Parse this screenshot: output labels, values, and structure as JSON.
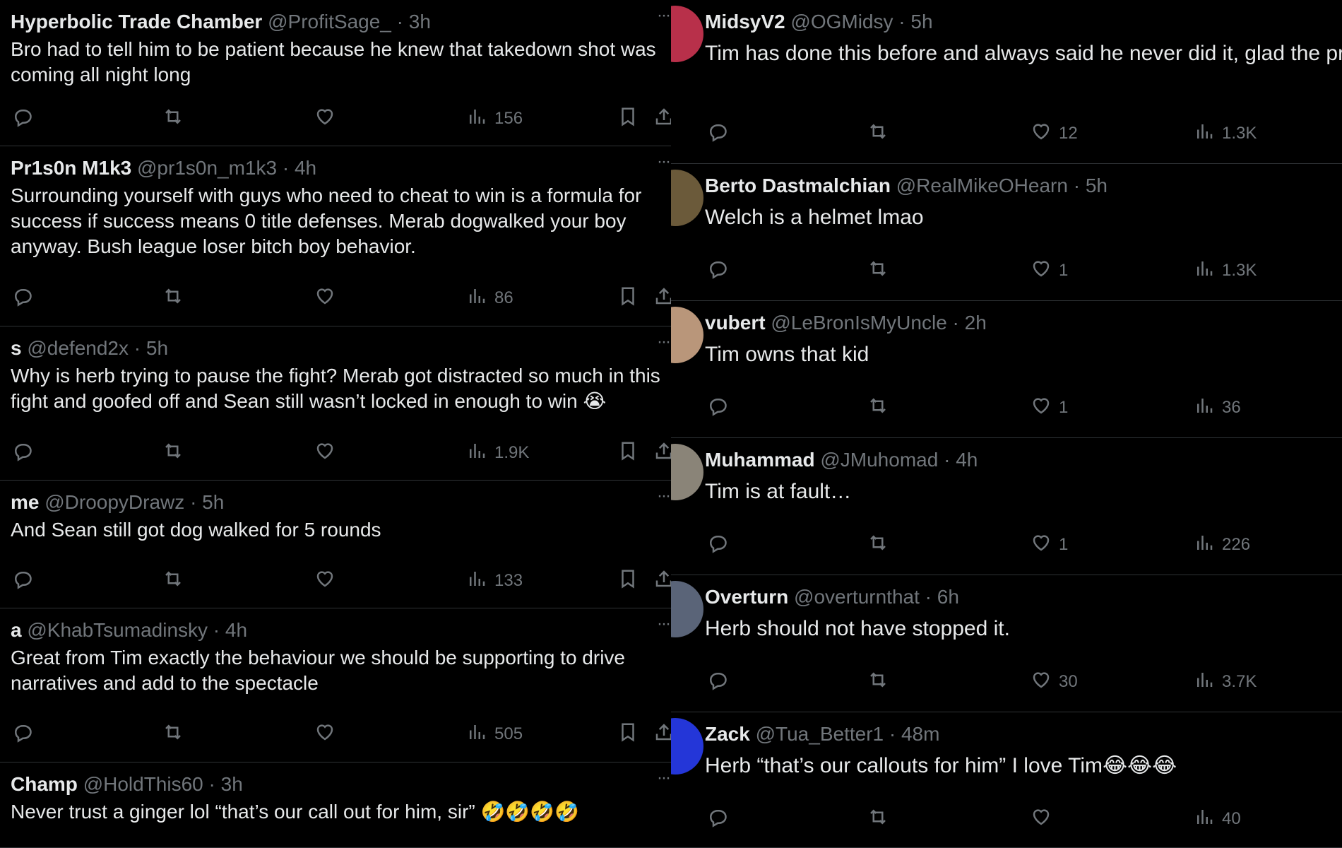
{
  "left_tweets": [
    {
      "name": "Hyperbolic Trade Chamber",
      "handle": "@ProfitSage_",
      "time": "3h",
      "text": "Bro had to tell him to be patient because he knew that takedown shot was\ncoming all night long",
      "views": "156"
    },
    {
      "name": "Pr1s0n M1k3",
      "handle": "@pr1s0n_m1k3",
      "time": "4h",
      "text": "Surrounding yourself with guys who need to cheat to win is a formula for\nsuccess if success means 0 title defenses. Merab dogwalked your boy\nanyway. Bush league loser bitch boy behavior.",
      "views": "86"
    },
    {
      "name": "s",
      "handle": "@defend2x",
      "time": "5h",
      "text": "Why is herb trying to pause the fight? Merab got distracted so much in this\nfight and goofed off and Sean still wasn’t locked in enough to win 😭",
      "views": "1.9K"
    },
    {
      "name": "me",
      "handle": "@DroopyDrawz",
      "time": "5h",
      "text": "And Sean still got dog walked for 5 rounds",
      "views": "133"
    },
    {
      "name": "a",
      "handle": "@KhabTsumadinsky",
      "time": "4h",
      "text": "Great from Tim exactly the behaviour we should be supporting to drive\nnarratives and add to the spectacle",
      "views": "505"
    },
    {
      "name": "Champ",
      "handle": "@HoldThis60",
      "time": "3h",
      "text": "Never trust a ginger lol “that’s our call out for him, sir” 🤣🤣🤣🤣",
      "views": ""
    }
  ],
  "right_tweets": [
    {
      "name": "MidsyV2",
      "handle": "@OGMidsy",
      "time": "5h",
      "text": "Tim has done this before and always said he never did it, glad the pr\nout there now lol",
      "likes": "12",
      "views": "1.3K",
      "avatar_color": "#b8304a"
    },
    {
      "name": "Berto Dastmalchian",
      "handle": "@RealMikeOHearn",
      "time": "5h",
      "text": "Welch is a helmet lmao",
      "likes": "1",
      "views": "1.3K",
      "avatar_color": "#6b5a3a"
    },
    {
      "name": "vubert",
      "handle": "@LeBronIsMyUncle",
      "time": "2h",
      "text": "Tim owns that kid",
      "likes": "1",
      "views": "36",
      "avatar_color": "#b9967a"
    },
    {
      "name": "Muhammad",
      "handle": "@JMuhomad",
      "time": "4h",
      "text": "Tim is at fault…",
      "likes": "1",
      "views": "226",
      "avatar_color": "#8a8478"
    },
    {
      "name": "Overturn",
      "handle": "@overturnthat",
      "time": "6h",
      "text": "Herb should not have stopped it.",
      "likes": "30",
      "views": "3.7K",
      "avatar_color": "#5a6478"
    },
    {
      "name": "Zack",
      "handle": "@Tua_Better1",
      "time": "48m",
      "text": "Herb “that’s our callouts for him” I love Tim😂😂😂",
      "likes": "",
      "views": "40",
      "avatar_color": "#2436d8"
    }
  ],
  "ui": {
    "separator": "·",
    "more": "···",
    "colors": {
      "background": "#000000",
      "text": "#e7e9ea",
      "muted": "#71767b",
      "divider": "#2f3336"
    }
  }
}
